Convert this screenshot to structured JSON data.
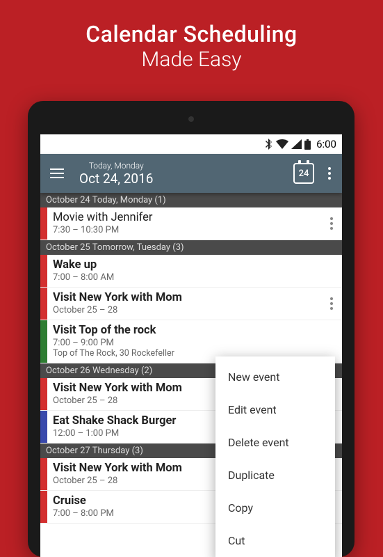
{
  "promo": {
    "line1": "Calendar Scheduling",
    "line2": "Made Easy"
  },
  "statusbar": {
    "time": "6:00"
  },
  "appbar": {
    "small": "Today, Monday",
    "big": "Oct 24, 2016",
    "today_num": "24"
  },
  "sections": [
    {
      "header": "October 24 Today, Monday (1)"
    },
    {
      "header": "October 25 Tomorrow, Tuesday (3)"
    },
    {
      "header": "October 26 Wednesday (2)"
    },
    {
      "header": "October 27 Thursday (3)"
    }
  ],
  "events": {
    "e0": {
      "title": "Movie with Jennifer",
      "time": "7:30 – 10:30 PM"
    },
    "e1": {
      "title": "Wake up",
      "time": "7:00 – 8:00 AM"
    },
    "e2": {
      "title": "Visit New York with Mom",
      "time": "October 25 – 28"
    },
    "e3": {
      "title": "Visit Top of the rock",
      "time": "7:00 – 9:00 PM",
      "location": "Top of The Rock, 30 Rockefeller"
    },
    "e4": {
      "title": "Visit New York with Mom",
      "time": "October 25 – 28"
    },
    "e5": {
      "title": "Eat Shake Shack Burger",
      "time": "12:00 – 1:00 PM"
    },
    "e6": {
      "title": "Visit New York with Mom",
      "time": "October 25 – 28"
    },
    "e7": {
      "title": "Cruise",
      "time": "7:00 – 8:00 PM"
    }
  },
  "menu": {
    "new": "New event",
    "edit": "Edit event",
    "delete": "Delete event",
    "duplicate": "Duplicate",
    "copy": "Copy",
    "cut": "Cut"
  }
}
